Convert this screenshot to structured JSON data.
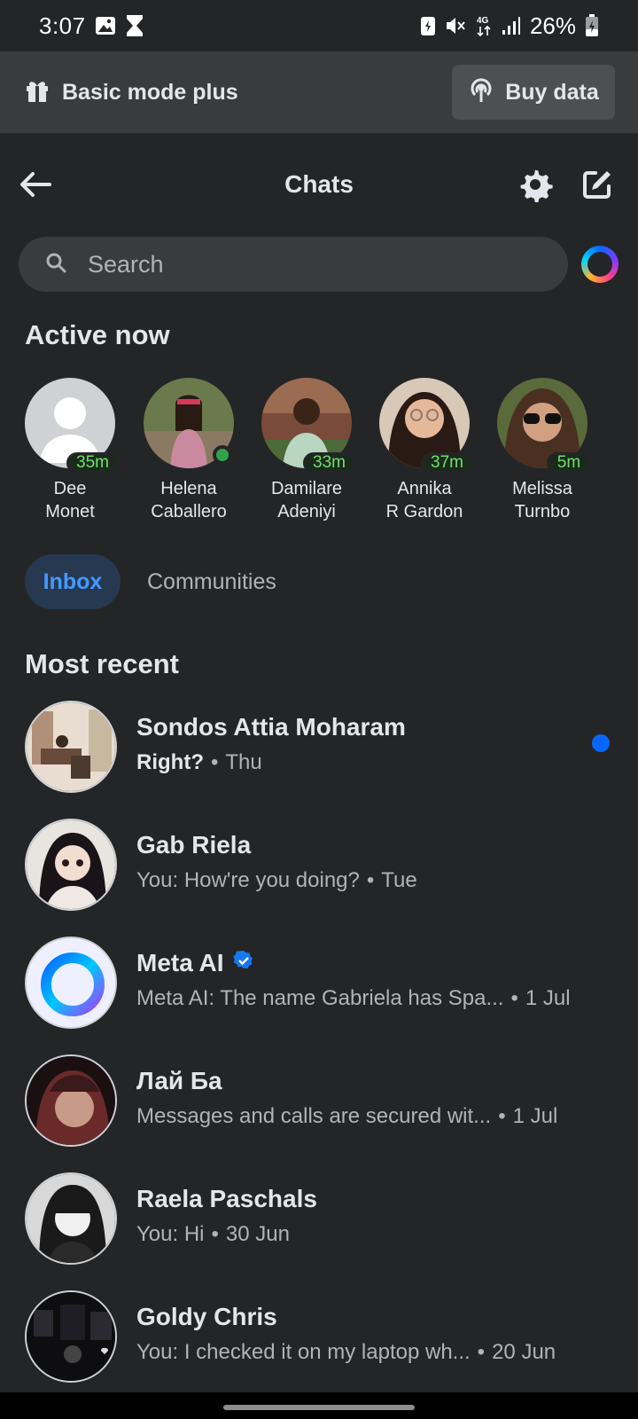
{
  "status_bar": {
    "time": "3:07",
    "battery": "26%"
  },
  "banner": {
    "title": "Basic mode plus",
    "buy_label": "Buy data"
  },
  "header": {
    "title": "Chats"
  },
  "search": {
    "placeholder": "Search"
  },
  "active_now": {
    "title": "Active now",
    "people": [
      {
        "name_line1": "Dee",
        "name_line2": "Monet",
        "badge": "35m"
      },
      {
        "name_line1": "Helena",
        "name_line2": "Caballero",
        "badge": ""
      },
      {
        "name_line1": "Damilare",
        "name_line2": "Adeniyi",
        "badge": "33m"
      },
      {
        "name_line1": "Annika",
        "name_line2": "R Gardon",
        "badge": "37m"
      },
      {
        "name_line1": "Melissa",
        "name_line2": "Turnbo",
        "badge": "5m"
      }
    ]
  },
  "tabs": {
    "inbox": "Inbox",
    "communities": "Communities"
  },
  "most_recent": {
    "title": "Most recent",
    "chats": [
      {
        "name": "Sondos Attia Moharam",
        "message": "Right?",
        "time": "Thu",
        "unread": true
      },
      {
        "name": "Gab Riela",
        "message": "You: How're you doing?",
        "time": "Tue",
        "unread": false
      },
      {
        "name": "Meta AI",
        "message": "Meta AI: The name Gabriela has Spa...",
        "time": "1 Jul",
        "unread": false,
        "verified": true
      },
      {
        "name": "Лай Ба",
        "message": "Messages and calls are secured wit...",
        "time": "1 Jul",
        "unread": false
      },
      {
        "name": "Raela Paschals",
        "message": "You: Hi",
        "time": "30 Jun",
        "unread": false
      },
      {
        "name": "Goldy Chris",
        "message": "You: I checked it on my laptop wh...",
        "time": "20 Jun",
        "unread": false
      }
    ]
  },
  "colors": {
    "background": "#242526",
    "accent": "#0866ff",
    "active_green": "#31a24c",
    "badge_text": "#6fe06b"
  }
}
